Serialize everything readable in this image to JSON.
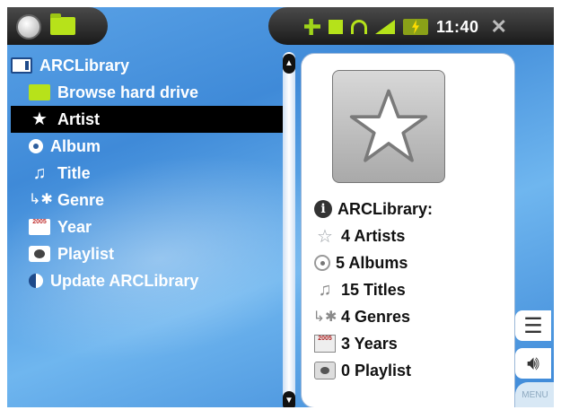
{
  "status_bar": {
    "time": "11:40",
    "icons": [
      "back-icon",
      "folder-icon",
      "power-plug-icon",
      "green-square-icon",
      "headphones-icon",
      "signal-icon",
      "battery-charging-icon",
      "close-icon"
    ]
  },
  "library_list": {
    "root": {
      "label": "ARCLibrary",
      "icon": "library-icon"
    },
    "items": [
      {
        "label": "Browse hard drive",
        "icon": "folder-icon"
      },
      {
        "label": "Artist",
        "icon": "star-icon",
        "selected": true
      },
      {
        "label": "Album",
        "icon": "disc-icon"
      },
      {
        "label": "Title",
        "icon": "music-note-icon"
      },
      {
        "label": "Genre",
        "icon": "genre-icon"
      },
      {
        "label": "Year",
        "icon": "calendar-icon"
      },
      {
        "label": "Playlist",
        "icon": "playlist-icon"
      },
      {
        "label": "Update ARCLibrary",
        "icon": "update-icon"
      }
    ],
    "year_icon_text": "2005"
  },
  "info_panel": {
    "header": "ARCLibrary:",
    "stats": [
      {
        "label": "4 Artists",
        "icon": "star-icon"
      },
      {
        "label": "5 Albums",
        "icon": "disc-icon"
      },
      {
        "label": "15 Titles",
        "icon": "music-note-icon"
      },
      {
        "label": "4 Genres",
        "icon": "genre-icon"
      },
      {
        "label": "3 Years",
        "icon": "calendar-icon"
      },
      {
        "label": "0 Playlist",
        "icon": "playlist-icon"
      }
    ]
  },
  "side_buttons": {
    "menu_label": "MENU"
  },
  "colors": {
    "background": "#4a94de",
    "selection": "#000000",
    "status_accent": "#b5e21a",
    "panel": "#ffffff"
  }
}
